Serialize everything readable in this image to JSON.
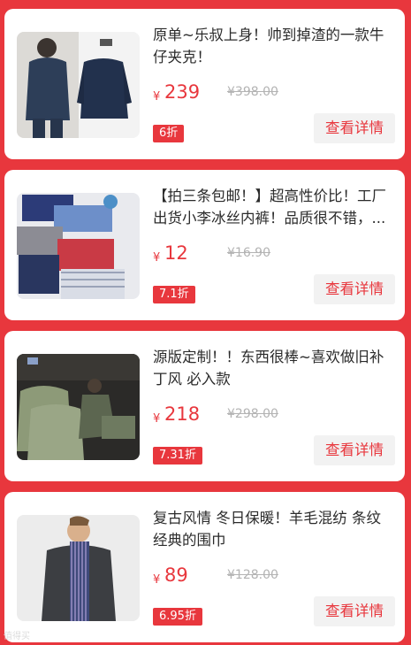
{
  "items": [
    {
      "title": "原单~乐叔上身！帅到掉渣的一款牛仔夹克！",
      "currency": "¥",
      "price": "239",
      "original_price": "¥398.00",
      "discount": "6折",
      "detail_label": "查看详情",
      "image_icon": "denim-jacket-photo"
    },
    {
      "title": "【拍三条包邮！】超高性价比！工厂出货小李冰丝内裤！品质很不错，...",
      "currency": "¥",
      "price": "12",
      "original_price": "¥16.90",
      "discount": "7.1折",
      "detail_label": "查看详情",
      "image_icon": "underwear-photo"
    },
    {
      "title": "源版定制！！东西很棒~喜欢做旧补丁风 必入款",
      "currency": "¥",
      "price": "218",
      "original_price": "¥298.00",
      "discount": "7.31折",
      "detail_label": "查看详情",
      "image_icon": "green-shirt-photo"
    },
    {
      "title": "复古风情 冬日保暖！羊毛混纺 条纹经典的围巾",
      "currency": "¥",
      "price": "89",
      "original_price": "¥128.00",
      "discount": "6.95折",
      "detail_label": "查看详情",
      "image_icon": "striped-scarf-photo"
    }
  ],
  "watermark": "值得买",
  "colors": {
    "accent": "#e8373d",
    "background": "#e8373d",
    "card": "#ffffff"
  }
}
